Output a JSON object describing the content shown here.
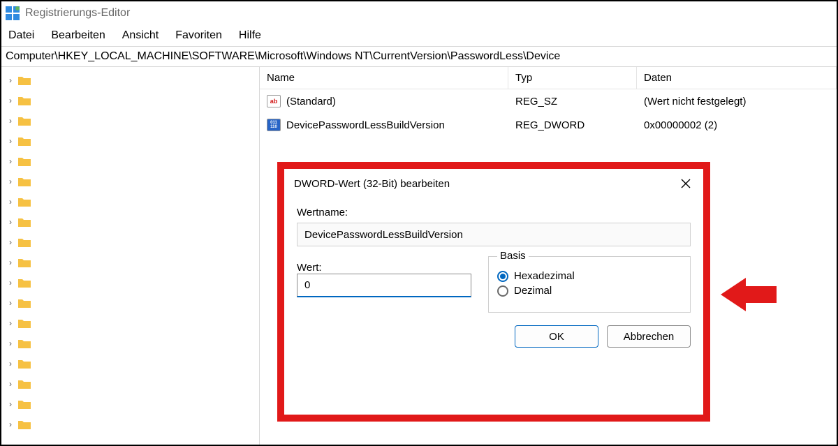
{
  "window": {
    "title": "Registrierungs-Editor"
  },
  "menu": {
    "items": [
      "Datei",
      "Bearbeiten",
      "Ansicht",
      "Favoriten",
      "Hilfe"
    ]
  },
  "address": {
    "path": "Computer\\HKEY_LOCAL_MACHINE\\SOFTWARE\\Microsoft\\Windows NT\\CurrentVersion\\PasswordLess\\Device"
  },
  "list": {
    "columns": {
      "name": "Name",
      "type": "Typ",
      "data": "Daten"
    },
    "rows": [
      {
        "icon": "sz",
        "name": "(Standard)",
        "type": "REG_SZ",
        "data": "(Wert nicht festgelegt)"
      },
      {
        "icon": "dword",
        "name": "DevicePasswordLessBuildVersion",
        "type": "REG_DWORD",
        "data": "0x00000002 (2)"
      }
    ]
  },
  "dialog": {
    "title": "DWORD-Wert (32-Bit) bearbeiten",
    "name_label": "Wertname:",
    "name_value": "DevicePasswordLessBuildVersion",
    "value_label": "Wert:",
    "value": "0",
    "basis_label": "Basis",
    "radio_hex": "Hexadezimal",
    "radio_dec": "Dezimal",
    "ok": "OK",
    "cancel": "Abbrechen"
  },
  "icons": {
    "sz_text": "ab",
    "dw_text": "011\n010"
  }
}
